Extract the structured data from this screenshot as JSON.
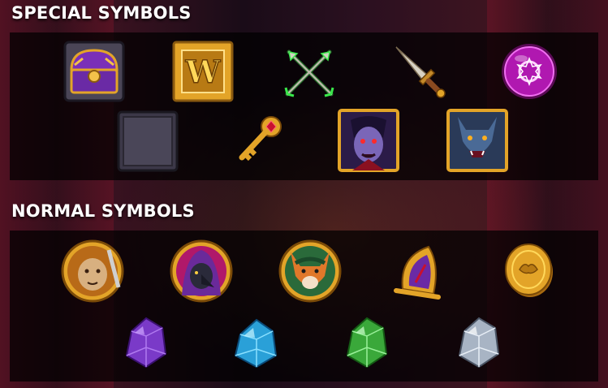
{
  "special": {
    "title": "SPECIAL SYMBOLS",
    "symbols": [
      "treasure-chest",
      "wild-w",
      "crossed-arrows",
      "dagger",
      "magic-orb",
      "blank-stone-tile",
      "golden-key",
      "vampire",
      "werewolf"
    ],
    "wild_letter": "W"
  },
  "normal": {
    "title": "NORMAL SYMBOLS",
    "symbols": [
      "lion",
      "raven-hood",
      "fox-archer",
      "ornate-helm",
      "gold-coin",
      "purple-gem",
      "blue-gem",
      "green-gem",
      "silver-gem"
    ]
  },
  "colors": {
    "gold": "#e3a428",
    "purple": "#7a2fb8",
    "magenta": "#d92ad6",
    "green_glow": "#39e84a",
    "panel_bg": "rgba(0,0,0,0.72)"
  }
}
